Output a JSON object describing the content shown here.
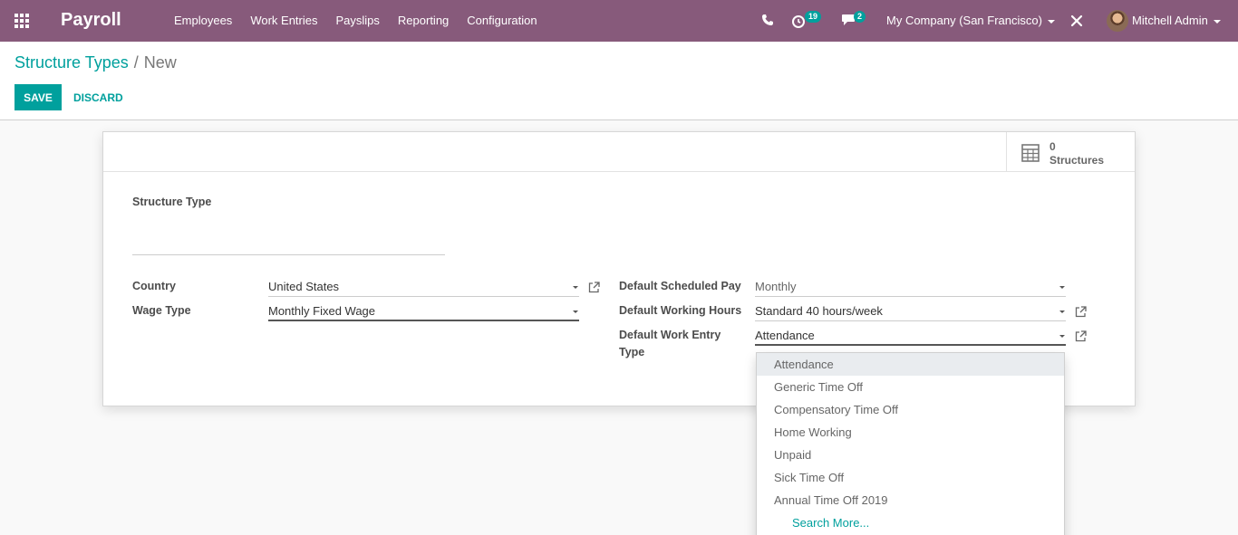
{
  "navbar": {
    "brand": "Payroll",
    "menu": [
      "Employees",
      "Work Entries",
      "Payslips",
      "Reporting",
      "Configuration"
    ],
    "activity_count": "19",
    "message_count": "2",
    "company": "My Company (San Francisco)",
    "user": "Mitchell Admin",
    "accent": "#875a7b"
  },
  "breadcrumb": {
    "parent": "Structure Types",
    "separator": "/",
    "current": "New"
  },
  "actions": {
    "save": "SAVE",
    "discard": "DISCARD",
    "primary_color": "#00a09d"
  },
  "smart_button": {
    "count": "0",
    "label": "Structures",
    "icon": "calculator-icon"
  },
  "form": {
    "name_label": "Structure Type",
    "name_value": "",
    "country_label": "Country",
    "country_value": "United States",
    "wage_type_label": "Wage Type",
    "wage_type_value": "Monthly Fixed Wage",
    "scheduled_pay_label": "Default Scheduled Pay",
    "scheduled_pay_value": "Monthly",
    "working_hours_label": "Default Working Hours",
    "working_hours_value": "Standard 40 hours/week",
    "work_entry_label_line1": "Default Work Entry",
    "work_entry_label_line2": "Type",
    "work_entry_value": "Attendance"
  },
  "dropdown": {
    "items": [
      "Attendance",
      "Generic Time Off",
      "Compensatory Time Off",
      "Home Working",
      "Unpaid",
      "Sick Time Off",
      "Annual Time Off 2019"
    ],
    "search_more": "Search More..."
  }
}
